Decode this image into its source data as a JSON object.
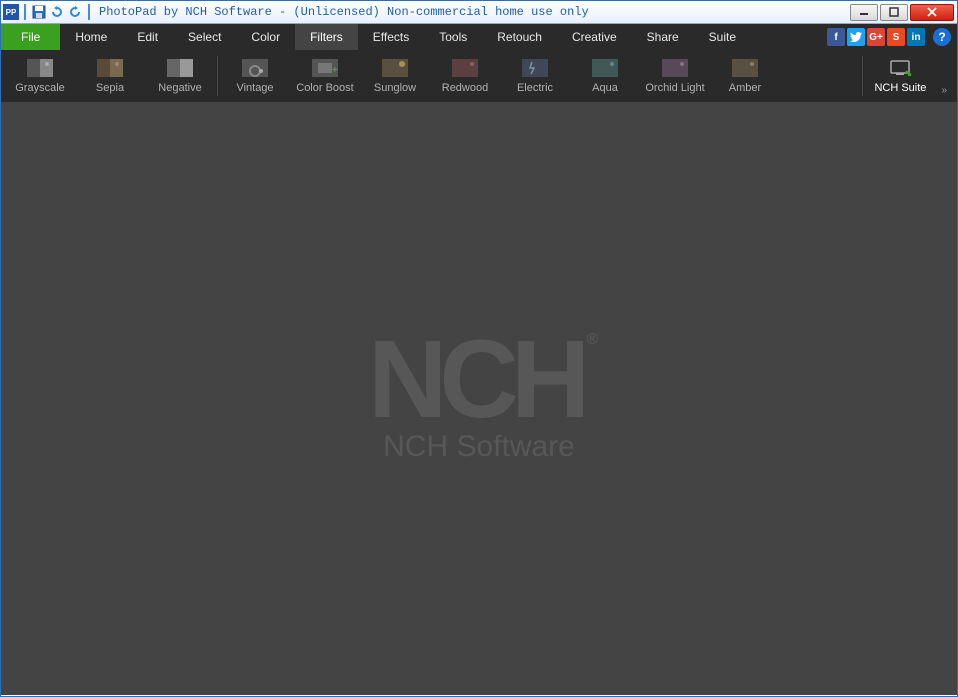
{
  "titlebar": {
    "app_title": "PhotoPad by NCH Software - (Unlicensed) Non-commercial home use only"
  },
  "menu": {
    "items": [
      "File",
      "Home",
      "Edit",
      "Select",
      "Color",
      "Filters",
      "Effects",
      "Tools",
      "Retouch",
      "Creative",
      "Share",
      "Suite"
    ],
    "active_index": 5
  },
  "social": {
    "fb": "f",
    "tw": "t",
    "gp": "G+",
    "su": "S",
    "li": "in",
    "help": "?"
  },
  "toolbar": {
    "items": [
      {
        "label": "Grayscale"
      },
      {
        "label": "Sepia"
      },
      {
        "label": "Negative"
      },
      {
        "label": "Vintage"
      },
      {
        "label": "Color Boost"
      },
      {
        "label": "Sunglow"
      },
      {
        "label": "Redwood"
      },
      {
        "label": "Electric"
      },
      {
        "label": "Aqua"
      },
      {
        "label": "Orchid Light"
      },
      {
        "label": "Amber"
      }
    ],
    "nch_suite": "NCH Suite"
  },
  "watermark": {
    "logo": "NCH",
    "text": "NCH Software",
    "reg": "®"
  }
}
